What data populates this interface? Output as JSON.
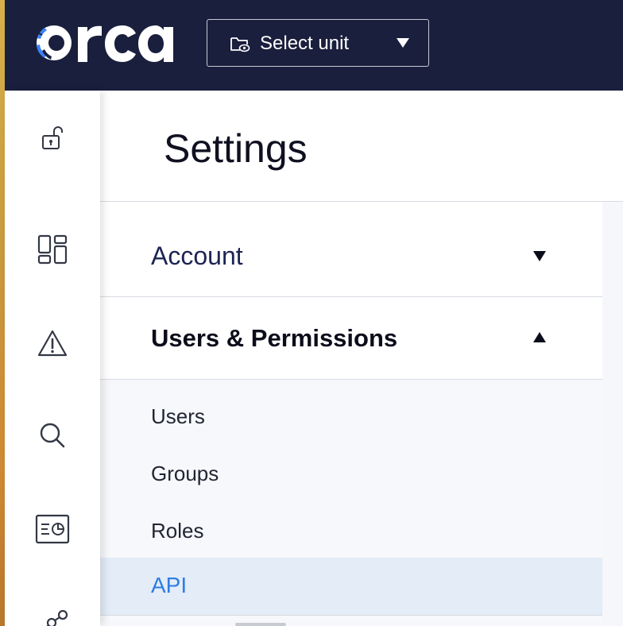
{
  "topbar": {
    "logo_text": "orca",
    "unit_select": {
      "label": "Select unit",
      "icon": "eye-folder-icon"
    },
    "background_color": "#1a1f3d"
  },
  "rail": {
    "items": [
      {
        "icon": "unlock-icon"
      },
      {
        "icon": "dashboard-icon"
      },
      {
        "icon": "alert-triangle-icon"
      },
      {
        "icon": "search-icon"
      },
      {
        "icon": "report-icon"
      },
      {
        "icon": "graph-icon"
      }
    ]
  },
  "page": {
    "title": "Settings"
  },
  "settings": {
    "sections": [
      {
        "label": "Account",
        "expanded": false
      },
      {
        "label": "Users & Permissions",
        "expanded": true
      }
    ],
    "sub_items": [
      {
        "label": "Users",
        "active": false
      },
      {
        "label": "Groups",
        "active": false
      },
      {
        "label": "Roles",
        "active": false
      },
      {
        "label": "API",
        "active": true
      }
    ]
  },
  "colors": {
    "accent": "#2f7de1",
    "active_row": "#e3ecf7",
    "nav_text": "#1c2452"
  }
}
